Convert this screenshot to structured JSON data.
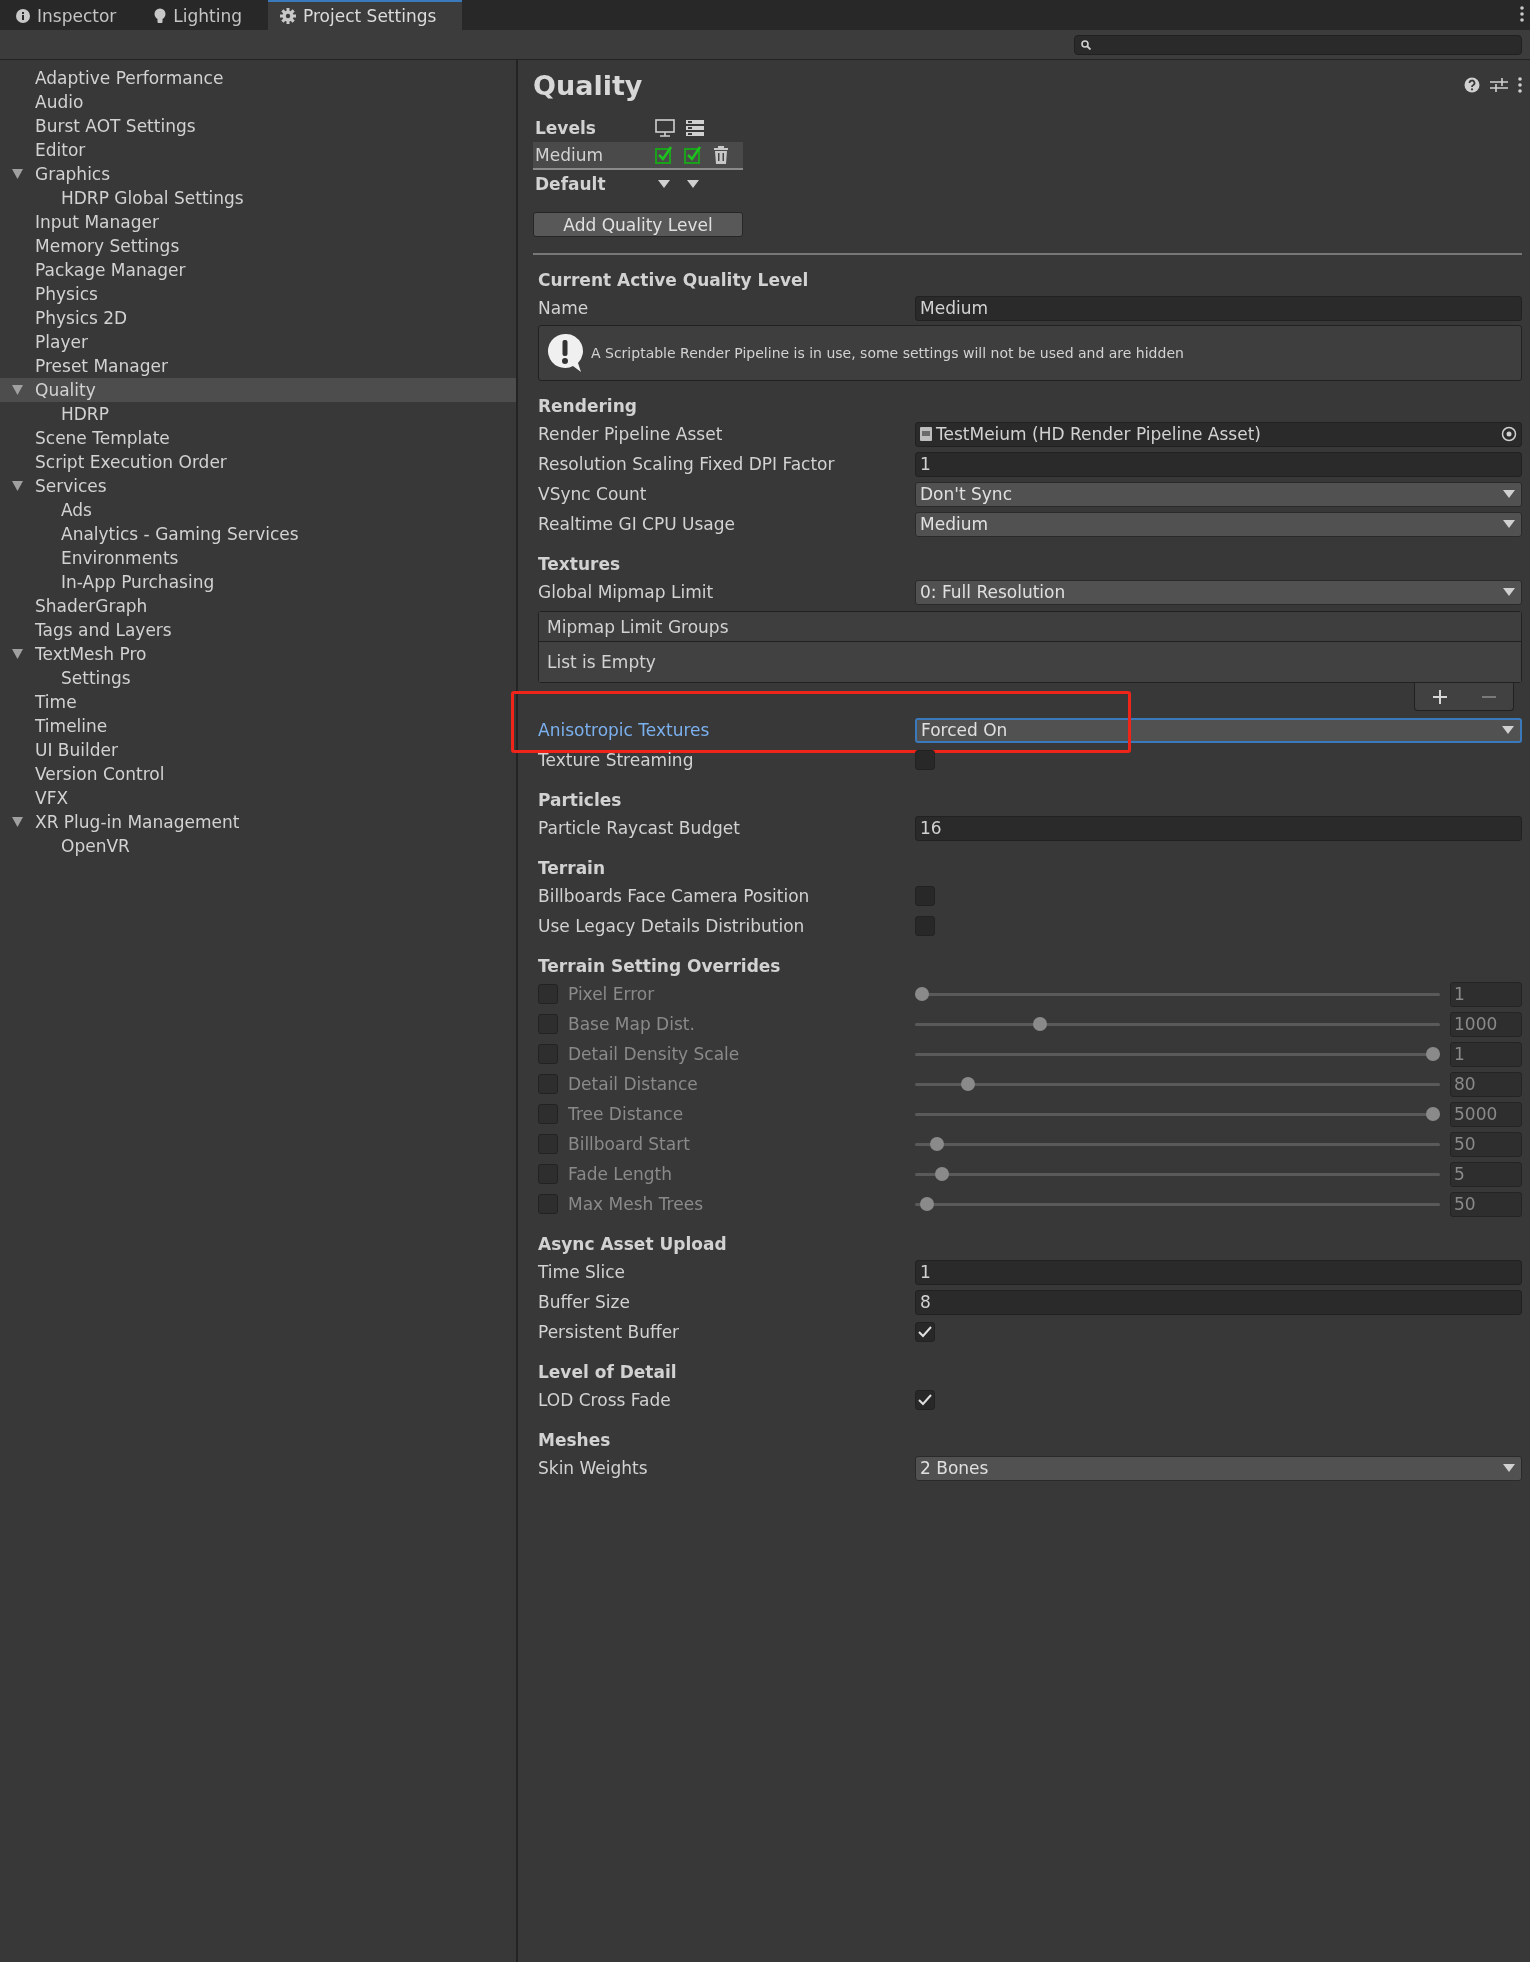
{
  "tabs": [
    {
      "label": "Inspector",
      "selected": false
    },
    {
      "label": "Lighting",
      "selected": false
    },
    {
      "label": "Project Settings",
      "selected": true
    }
  ],
  "sidebar": {
    "items": [
      {
        "label": "Adaptive Performance",
        "selected": false
      },
      {
        "label": "Audio",
        "selected": false
      },
      {
        "label": "Burst AOT Settings",
        "selected": false
      },
      {
        "label": "Editor",
        "selected": false
      },
      {
        "label": "Graphics",
        "selected": false,
        "expanded": true,
        "children": [
          {
            "label": "HDRP Global Settings",
            "selected": false
          }
        ]
      },
      {
        "label": "Input Manager",
        "selected": false
      },
      {
        "label": "Memory Settings",
        "selected": false
      },
      {
        "label": "Package Manager",
        "selected": false
      },
      {
        "label": "Physics",
        "selected": false
      },
      {
        "label": "Physics 2D",
        "selected": false
      },
      {
        "label": "Player",
        "selected": false
      },
      {
        "label": "Preset Manager",
        "selected": false
      },
      {
        "label": "Quality",
        "selected": true,
        "expanded": true,
        "children": [
          {
            "label": "HDRP",
            "selected": false
          }
        ]
      },
      {
        "label": "Scene Template",
        "selected": false
      },
      {
        "label": "Script Execution Order",
        "selected": false
      },
      {
        "label": "Services",
        "selected": false,
        "expanded": true,
        "children": [
          {
            "label": "Ads",
            "selected": false
          },
          {
            "label": "Analytics - Gaming Services",
            "selected": false
          },
          {
            "label": "Environments",
            "selected": false
          },
          {
            "label": "In-App Purchasing",
            "selected": false
          }
        ]
      },
      {
        "label": "ShaderGraph",
        "selected": false
      },
      {
        "label": "Tags and Layers",
        "selected": false
      },
      {
        "label": "TextMesh Pro",
        "selected": false,
        "expanded": true,
        "children": [
          {
            "label": "Settings",
            "selected": false
          }
        ]
      },
      {
        "label": "Time",
        "selected": false
      },
      {
        "label": "Timeline",
        "selected": false
      },
      {
        "label": "UI Builder",
        "selected": false
      },
      {
        "label": "Version Control",
        "selected": false
      },
      {
        "label": "VFX",
        "selected": false
      },
      {
        "label": "XR Plug-in Management",
        "selected": false,
        "expanded": true,
        "children": [
          {
            "label": "OpenVR",
            "selected": false
          }
        ]
      }
    ]
  },
  "inspector": {
    "title": "Quality",
    "levels": {
      "label": "Levels",
      "rows": [
        {
          "name": "Medium",
          "selected": true,
          "platforms": [
            {
              "checked": true
            },
            {
              "checked": true
            }
          ]
        }
      ],
      "default_label": "Default"
    },
    "add_button": "Add Quality Level",
    "sections": [
      {
        "title": "Current Active Quality Level",
        "rows": [
          {
            "kind": "field",
            "label": "Name",
            "value": "Medium"
          },
          {
            "kind": "info",
            "text": "A Scriptable Render Pipeline is in use, some settings will not be used and are hidden"
          }
        ]
      },
      {
        "title": "Rendering",
        "rows": [
          {
            "kind": "object",
            "label": "Render Pipeline Asset",
            "value": "TestMeium (HD Render Pipeline Asset)"
          },
          {
            "kind": "field",
            "label": "Resolution Scaling Fixed DPI Factor",
            "value": "1"
          },
          {
            "kind": "dropdown",
            "label": "VSync Count",
            "value": "Don't Sync"
          },
          {
            "kind": "dropdown",
            "label": "Realtime GI CPU Usage",
            "value": "Medium"
          }
        ]
      },
      {
        "title": "Textures",
        "rows": [
          {
            "kind": "dropdown",
            "label": "Global Mipmap Limit",
            "value": "0: Full Resolution"
          },
          {
            "kind": "list",
            "label": "Mipmap Limit Groups",
            "empty_text": "List is Empty"
          },
          {
            "kind": "dropdown",
            "label": "Anisotropic Textures",
            "value": "Forced On",
            "focused": true,
            "highlighted": true
          },
          {
            "kind": "checkbox",
            "label": "Texture Streaming",
            "checked": false
          }
        ]
      },
      {
        "title": "Particles",
        "rows": [
          {
            "kind": "field",
            "label": "Particle Raycast Budget",
            "value": "16"
          }
        ]
      },
      {
        "title": "Terrain",
        "rows": [
          {
            "kind": "checkbox",
            "label": "Billboards Face Camera Position",
            "checked": false
          },
          {
            "kind": "checkbox",
            "label": "Use Legacy Details Distribution",
            "checked": false
          }
        ]
      },
      {
        "title": "Terrain Setting Overrides",
        "rows": [
          {
            "kind": "slider",
            "label": "Pixel Error",
            "checked": false,
            "level": 0,
            "value": "1"
          },
          {
            "kind": "slider",
            "label": "Base Map Dist.",
            "checked": false,
            "level": 0.23,
            "value": "1000"
          },
          {
            "kind": "slider",
            "label": "Detail Density Scale",
            "checked": false,
            "level": 1,
            "value": "1"
          },
          {
            "kind": "slider",
            "label": "Detail Distance",
            "checked": false,
            "level": 0.09,
            "value": "80"
          },
          {
            "kind": "slider",
            "label": "Tree Distance",
            "checked": false,
            "level": 1,
            "value": "5000"
          },
          {
            "kind": "slider",
            "label": "Billboard Start",
            "checked": false,
            "level": 0.03,
            "value": "50"
          },
          {
            "kind": "slider",
            "label": "Fade Length",
            "checked": false,
            "level": 0.04,
            "value": "5"
          },
          {
            "kind": "slider",
            "label": "Max Mesh Trees",
            "checked": false,
            "level": 0.01,
            "value": "50"
          }
        ]
      },
      {
        "title": "Async Asset Upload",
        "rows": [
          {
            "kind": "field",
            "label": "Time Slice",
            "value": "1"
          },
          {
            "kind": "field",
            "label": "Buffer Size",
            "value": "8"
          },
          {
            "kind": "checkbox",
            "label": "Persistent Buffer",
            "checked": true
          }
        ]
      },
      {
        "title": "Level of Detail",
        "rows": [
          {
            "kind": "checkbox",
            "label": "LOD Cross Fade",
            "checked": true
          }
        ]
      },
      {
        "title": "Meshes",
        "rows": [
          {
            "kind": "dropdown",
            "label": "Skin Weights",
            "value": "2 Bones"
          }
        ]
      }
    ]
  }
}
